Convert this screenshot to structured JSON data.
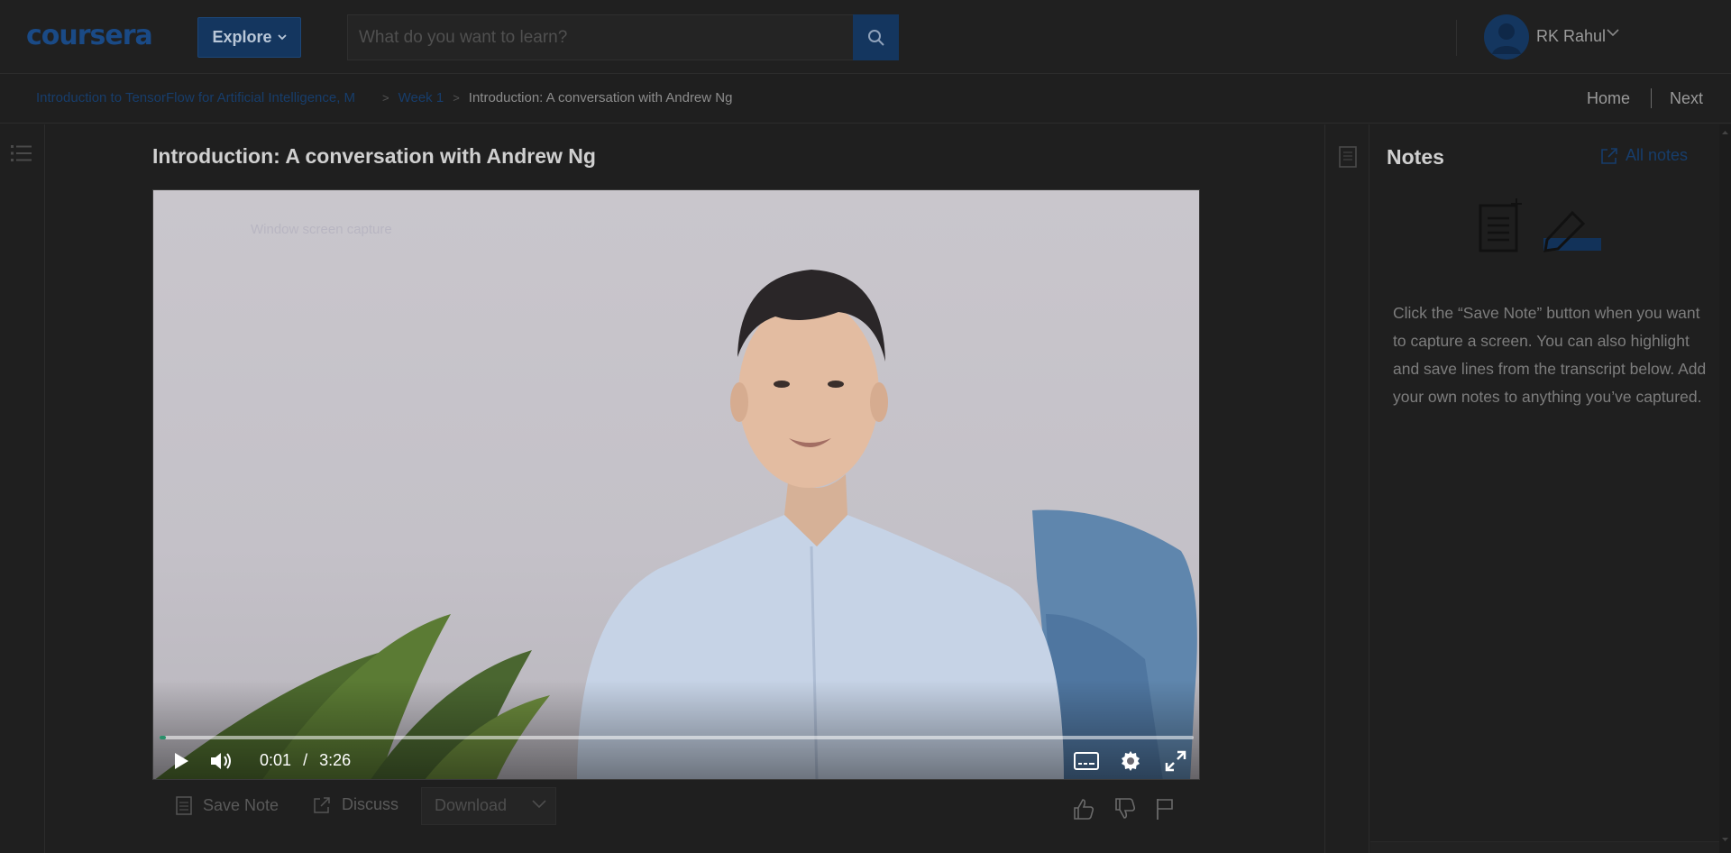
{
  "header": {
    "logo": "coursera",
    "explore_label": "Explore",
    "search_placeholder": "What do you want to learn?",
    "user_name": "RK Rahul"
  },
  "breadcrumb": {
    "items": [
      "Introduction to TensorFlow for Artificial Intelligence, M",
      "Week 1",
      "Introduction: A conversation with Andrew Ng"
    ],
    "home_label": "Home",
    "next_label": "Next"
  },
  "main": {
    "title": "Introduction: A conversation with Andrew Ng",
    "video": {
      "watermark": "Window screen capture",
      "current_time": "0:01",
      "time_sep": "/",
      "duration": "3:26",
      "progress": 0.005
    },
    "actions": {
      "save_note": "Save Note",
      "discuss": "Discuss",
      "download": "Download"
    }
  },
  "notes": {
    "title": "Notes",
    "all_notes": "All notes",
    "help_text": "Click the “Save Note” button when you want to capture a screen. You can also highlight and save lines from the transcript below. Add your own notes to anything you’ve captured."
  },
  "colors": {
    "brand": "#14365f",
    "progress": "#2a8f6a"
  }
}
